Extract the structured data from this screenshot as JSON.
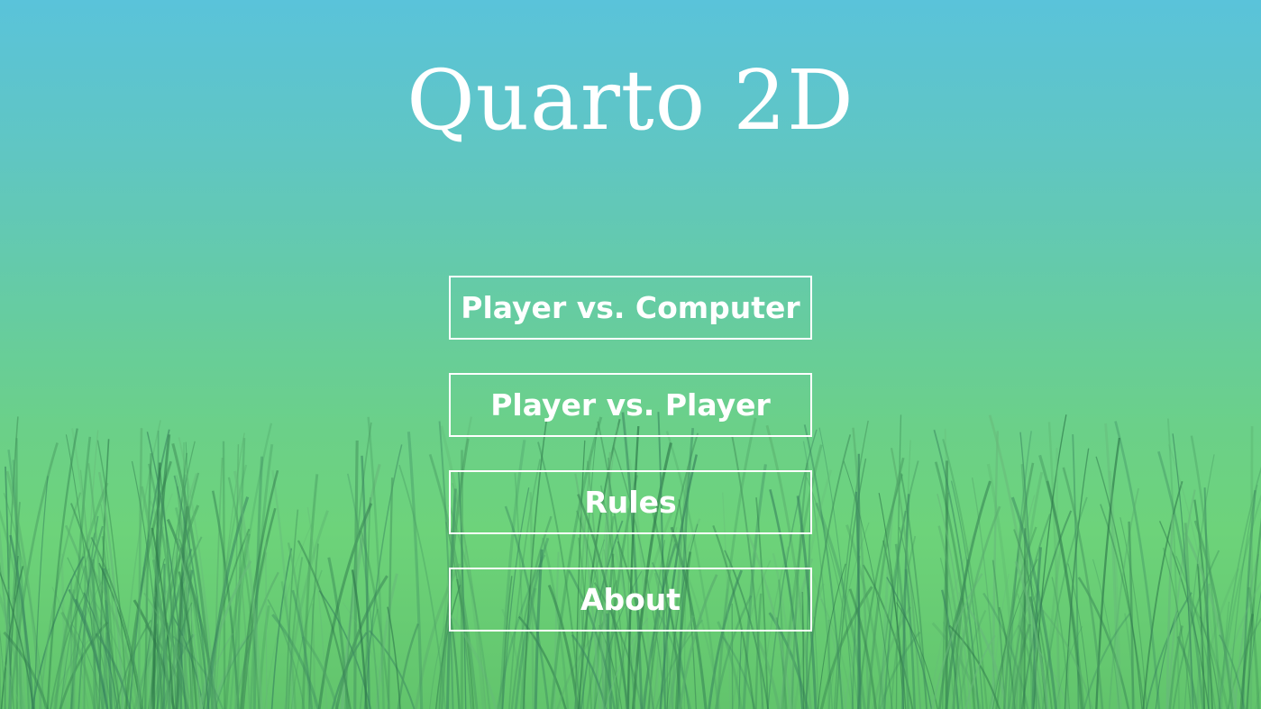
{
  "app": {
    "title": "Quarto 2D"
  },
  "menu": {
    "items": [
      {
        "label": "Player vs. Computer"
      },
      {
        "label": "Player vs. Player"
      },
      {
        "label": "Rules"
      },
      {
        "label": "About"
      }
    ]
  },
  "colors": {
    "sky_top": "#5ac3da",
    "meadow": "#6dd37a",
    "grass_dark": "#3f8f5a",
    "text": "#ffffff"
  },
  "background": {
    "decoration": "grass-field"
  }
}
